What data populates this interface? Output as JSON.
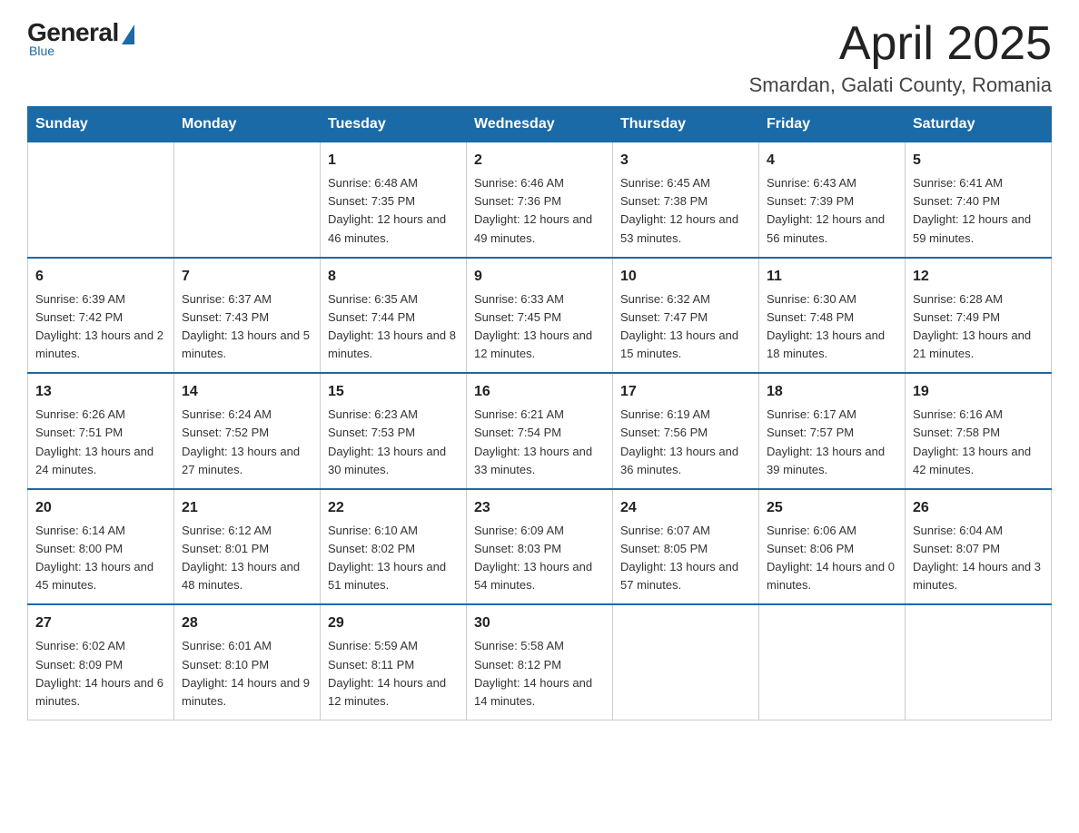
{
  "logo": {
    "general": "General",
    "blue": "Blue",
    "subtitle": "Blue"
  },
  "header": {
    "title": "April 2025",
    "location": "Smardan, Galati County, Romania"
  },
  "days_of_week": [
    "Sunday",
    "Monday",
    "Tuesday",
    "Wednesday",
    "Thursday",
    "Friday",
    "Saturday"
  ],
  "weeks": [
    [
      {
        "day": "",
        "info": ""
      },
      {
        "day": "",
        "info": ""
      },
      {
        "day": "1",
        "info": "Sunrise: 6:48 AM\nSunset: 7:35 PM\nDaylight: 12 hours\nand 46 minutes."
      },
      {
        "day": "2",
        "info": "Sunrise: 6:46 AM\nSunset: 7:36 PM\nDaylight: 12 hours\nand 49 minutes."
      },
      {
        "day": "3",
        "info": "Sunrise: 6:45 AM\nSunset: 7:38 PM\nDaylight: 12 hours\nand 53 minutes."
      },
      {
        "day": "4",
        "info": "Sunrise: 6:43 AM\nSunset: 7:39 PM\nDaylight: 12 hours\nand 56 minutes."
      },
      {
        "day": "5",
        "info": "Sunrise: 6:41 AM\nSunset: 7:40 PM\nDaylight: 12 hours\nand 59 minutes."
      }
    ],
    [
      {
        "day": "6",
        "info": "Sunrise: 6:39 AM\nSunset: 7:42 PM\nDaylight: 13 hours\nand 2 minutes."
      },
      {
        "day": "7",
        "info": "Sunrise: 6:37 AM\nSunset: 7:43 PM\nDaylight: 13 hours\nand 5 minutes."
      },
      {
        "day": "8",
        "info": "Sunrise: 6:35 AM\nSunset: 7:44 PM\nDaylight: 13 hours\nand 8 minutes."
      },
      {
        "day": "9",
        "info": "Sunrise: 6:33 AM\nSunset: 7:45 PM\nDaylight: 13 hours\nand 12 minutes."
      },
      {
        "day": "10",
        "info": "Sunrise: 6:32 AM\nSunset: 7:47 PM\nDaylight: 13 hours\nand 15 minutes."
      },
      {
        "day": "11",
        "info": "Sunrise: 6:30 AM\nSunset: 7:48 PM\nDaylight: 13 hours\nand 18 minutes."
      },
      {
        "day": "12",
        "info": "Sunrise: 6:28 AM\nSunset: 7:49 PM\nDaylight: 13 hours\nand 21 minutes."
      }
    ],
    [
      {
        "day": "13",
        "info": "Sunrise: 6:26 AM\nSunset: 7:51 PM\nDaylight: 13 hours\nand 24 minutes."
      },
      {
        "day": "14",
        "info": "Sunrise: 6:24 AM\nSunset: 7:52 PM\nDaylight: 13 hours\nand 27 minutes."
      },
      {
        "day": "15",
        "info": "Sunrise: 6:23 AM\nSunset: 7:53 PM\nDaylight: 13 hours\nand 30 minutes."
      },
      {
        "day": "16",
        "info": "Sunrise: 6:21 AM\nSunset: 7:54 PM\nDaylight: 13 hours\nand 33 minutes."
      },
      {
        "day": "17",
        "info": "Sunrise: 6:19 AM\nSunset: 7:56 PM\nDaylight: 13 hours\nand 36 minutes."
      },
      {
        "day": "18",
        "info": "Sunrise: 6:17 AM\nSunset: 7:57 PM\nDaylight: 13 hours\nand 39 minutes."
      },
      {
        "day": "19",
        "info": "Sunrise: 6:16 AM\nSunset: 7:58 PM\nDaylight: 13 hours\nand 42 minutes."
      }
    ],
    [
      {
        "day": "20",
        "info": "Sunrise: 6:14 AM\nSunset: 8:00 PM\nDaylight: 13 hours\nand 45 minutes."
      },
      {
        "day": "21",
        "info": "Sunrise: 6:12 AM\nSunset: 8:01 PM\nDaylight: 13 hours\nand 48 minutes."
      },
      {
        "day": "22",
        "info": "Sunrise: 6:10 AM\nSunset: 8:02 PM\nDaylight: 13 hours\nand 51 minutes."
      },
      {
        "day": "23",
        "info": "Sunrise: 6:09 AM\nSunset: 8:03 PM\nDaylight: 13 hours\nand 54 minutes."
      },
      {
        "day": "24",
        "info": "Sunrise: 6:07 AM\nSunset: 8:05 PM\nDaylight: 13 hours\nand 57 minutes."
      },
      {
        "day": "25",
        "info": "Sunrise: 6:06 AM\nSunset: 8:06 PM\nDaylight: 14 hours\nand 0 minutes."
      },
      {
        "day": "26",
        "info": "Sunrise: 6:04 AM\nSunset: 8:07 PM\nDaylight: 14 hours\nand 3 minutes."
      }
    ],
    [
      {
        "day": "27",
        "info": "Sunrise: 6:02 AM\nSunset: 8:09 PM\nDaylight: 14 hours\nand 6 minutes."
      },
      {
        "day": "28",
        "info": "Sunrise: 6:01 AM\nSunset: 8:10 PM\nDaylight: 14 hours\nand 9 minutes."
      },
      {
        "day": "29",
        "info": "Sunrise: 5:59 AM\nSunset: 8:11 PM\nDaylight: 14 hours\nand 12 minutes."
      },
      {
        "day": "30",
        "info": "Sunrise: 5:58 AM\nSunset: 8:12 PM\nDaylight: 14 hours\nand 14 minutes."
      },
      {
        "day": "",
        "info": ""
      },
      {
        "day": "",
        "info": ""
      },
      {
        "day": "",
        "info": ""
      }
    ]
  ]
}
